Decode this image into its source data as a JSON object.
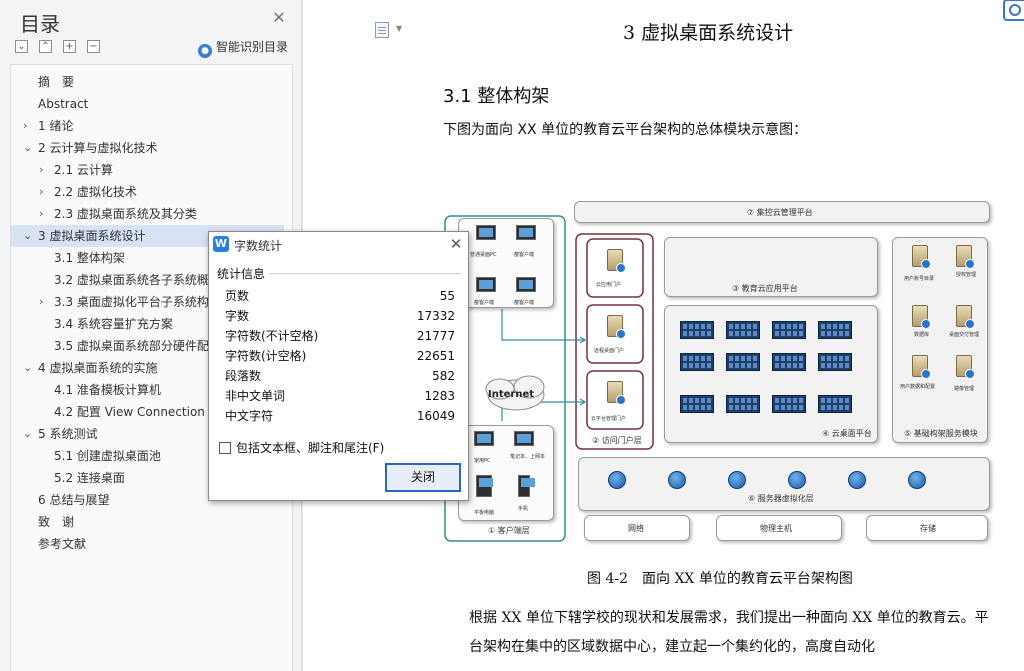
{
  "sidebar": {
    "title": "目录",
    "smart_label": "智能识别目录",
    "toc": [
      {
        "label": "摘　要",
        "level": 1,
        "expand": ""
      },
      {
        "label": "Abstract",
        "level": 1,
        "expand": ""
      },
      {
        "label": "1 绪论",
        "level": 1,
        "expand": "collapsed"
      },
      {
        "label": "2 云计算与虚拟化技术",
        "level": 1,
        "expand": "expanded"
      },
      {
        "label": "2.1 云计算",
        "level": 2,
        "expand": "collapsed"
      },
      {
        "label": "2.2  虚拟化技术",
        "level": 2,
        "expand": "collapsed"
      },
      {
        "label": "2.3  虚拟桌面系统及其分类",
        "level": 2,
        "expand": "collapsed"
      },
      {
        "label": "3 虚拟桌面系统设计",
        "level": 1,
        "expand": "expanded",
        "active": true
      },
      {
        "label": "3.1 整体构架",
        "level": 2,
        "expand": ""
      },
      {
        "label": "3.2 虚拟桌面系统各子系统概",
        "level": 2,
        "expand": ""
      },
      {
        "label": "3.3 桌面虚拟化平台子系统构",
        "level": 2,
        "expand": "collapsed"
      },
      {
        "label": "3.4 系统容量扩充方案",
        "level": 2,
        "expand": ""
      },
      {
        "label": "3.5 虚拟桌面系统部分硬件配",
        "level": 2,
        "expand": ""
      },
      {
        "label": "4 虚拟桌面系统的实施",
        "level": 1,
        "expand": "expanded"
      },
      {
        "label": "4.1 准备模板计算机",
        "level": 2,
        "expand": ""
      },
      {
        "label": "4.2 配置 View Connection S",
        "level": 2,
        "expand": ""
      },
      {
        "label": "5 系统测试",
        "level": 1,
        "expand": "expanded"
      },
      {
        "label": "5.1 创建虚拟桌面池",
        "level": 2,
        "expand": ""
      },
      {
        "label": "5.2  连接桌面",
        "level": 2,
        "expand": ""
      },
      {
        "label": "6 总结与展望",
        "level": 1,
        "expand": ""
      },
      {
        "label": "致　谢",
        "level": 1,
        "expand": ""
      },
      {
        "label": "参考文献",
        "level": 1,
        "expand": ""
      }
    ]
  },
  "document": {
    "heading1": "3 虚拟桌面系统设计",
    "heading2": "3.1 整体构架",
    "intro": "下图为面向 XX 单位的教育云平台架构的总体模块示意图：",
    "caption": "图 4-2　面向 XX 单位的教育云平台架构图",
    "paragraph": "根据 XX 单位下辖学校的现状和发展需求，我们提出一种面向 XX 单位的教育云。平台架构在集中的区域数据中心，建立起一个集约化的，高度自动化"
  },
  "figure": {
    "mgmt": "⑦ 集控云管理平台",
    "client_layer": "① 客户端层",
    "portal_layer": "② 访问门户层",
    "edu_app": "③ 教育云应用平台",
    "cloud_desktop": "④ 云桌面平台",
    "base_services": "⑤ 基础构架服务模块",
    "server_virt": "⑥ 服务器虚拟化层",
    "internet": "Internet",
    "network": "网络",
    "physical_host": "物理主机",
    "storage": "存储",
    "client_devices": [
      "普通桌面PC",
      "瘦客户端",
      "瘦客户端",
      "瘦客户端",
      "家用PC",
      "笔记本、上网本",
      "平板电脑",
      "手机"
    ],
    "portals": [
      "云应用门户",
      "远程桌面门户",
      "云平台管理门户"
    ],
    "services": [
      "用户账号目录",
      "授权管理",
      "数据库",
      "桌面交付管理",
      "用户数据和配置",
      "镜像管理"
    ]
  },
  "dialog": {
    "title": "字数统计",
    "section": "统计信息",
    "stats": [
      {
        "label": "页数",
        "value": "55"
      },
      {
        "label": "字数",
        "value": "17332"
      },
      {
        "label": "字符数(不计空格)",
        "value": "21777"
      },
      {
        "label": "字符数(计空格)",
        "value": "22651"
      },
      {
        "label": "段落数",
        "value": "582"
      },
      {
        "label": "非中文单词",
        "value": "1283"
      },
      {
        "label": "中文字符",
        "value": "16049"
      }
    ],
    "checkbox_label": "包括文本框、脚注和尾注(F)",
    "checkbox_checked": false,
    "close_button": "关闭"
  },
  "colors": {
    "accent": "#2a66c8",
    "toc_active": "#d7e2f4",
    "portal_border": "#7a2f3c",
    "client_border": "#2f8f8f",
    "connector": "#2f8fa0"
  }
}
